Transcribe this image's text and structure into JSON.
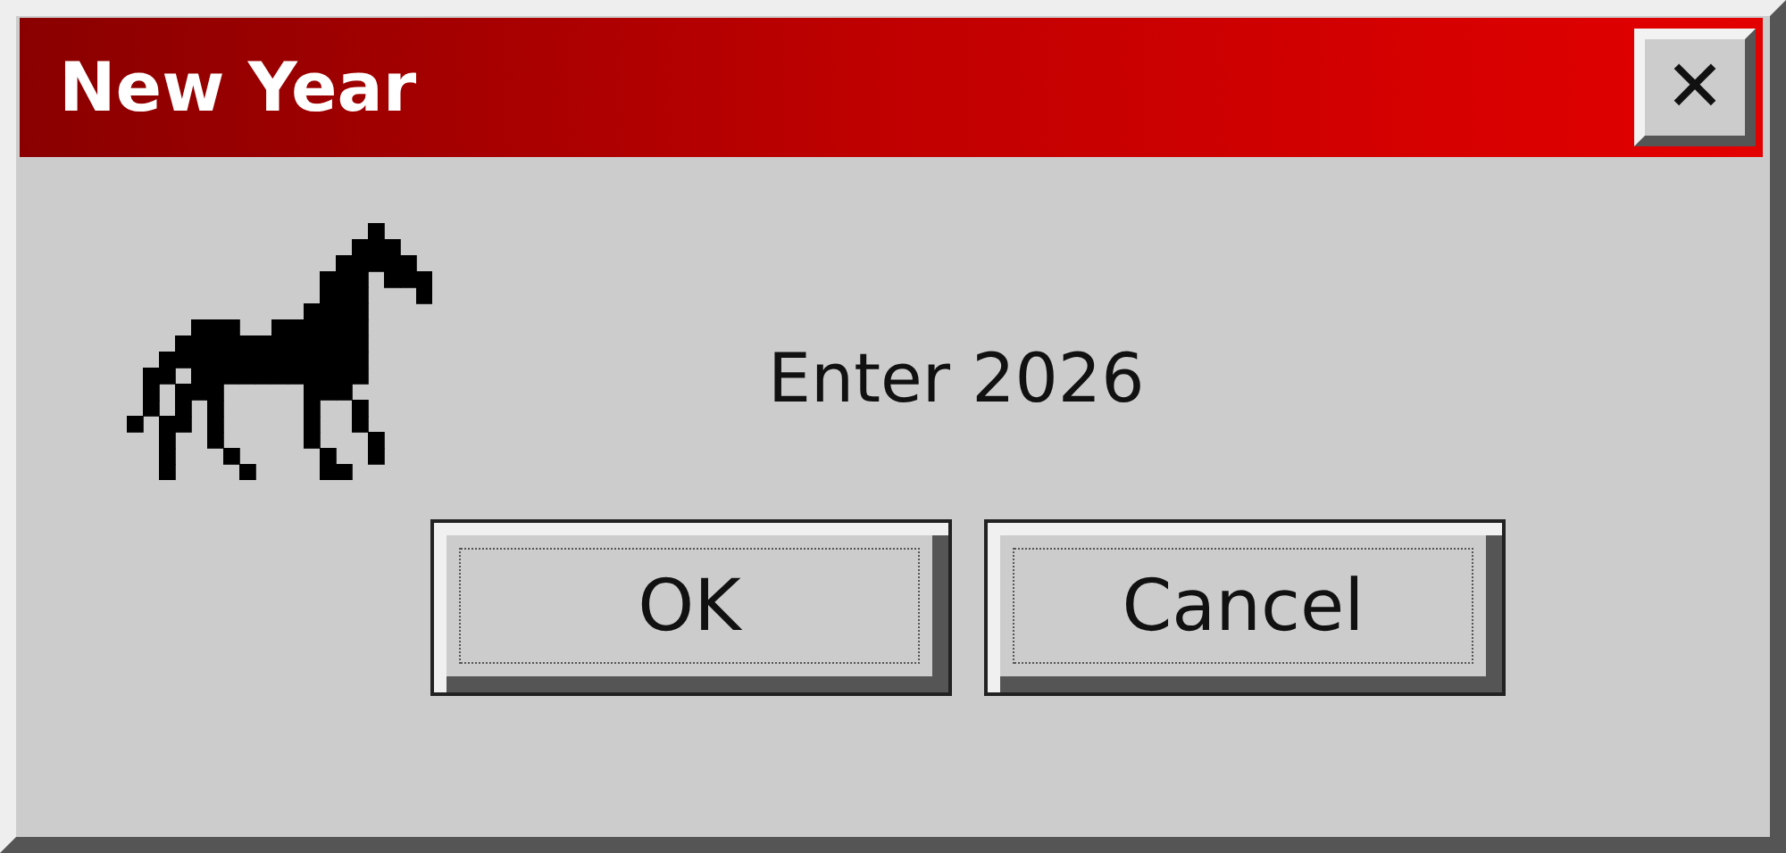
{
  "window": {
    "title": "New Year",
    "close_button": "✕"
  },
  "message": "Enter 2026",
  "buttons": [
    {
      "label": "OK",
      "focused": true
    },
    {
      "label": "Cancel",
      "focused": true
    }
  ]
}
